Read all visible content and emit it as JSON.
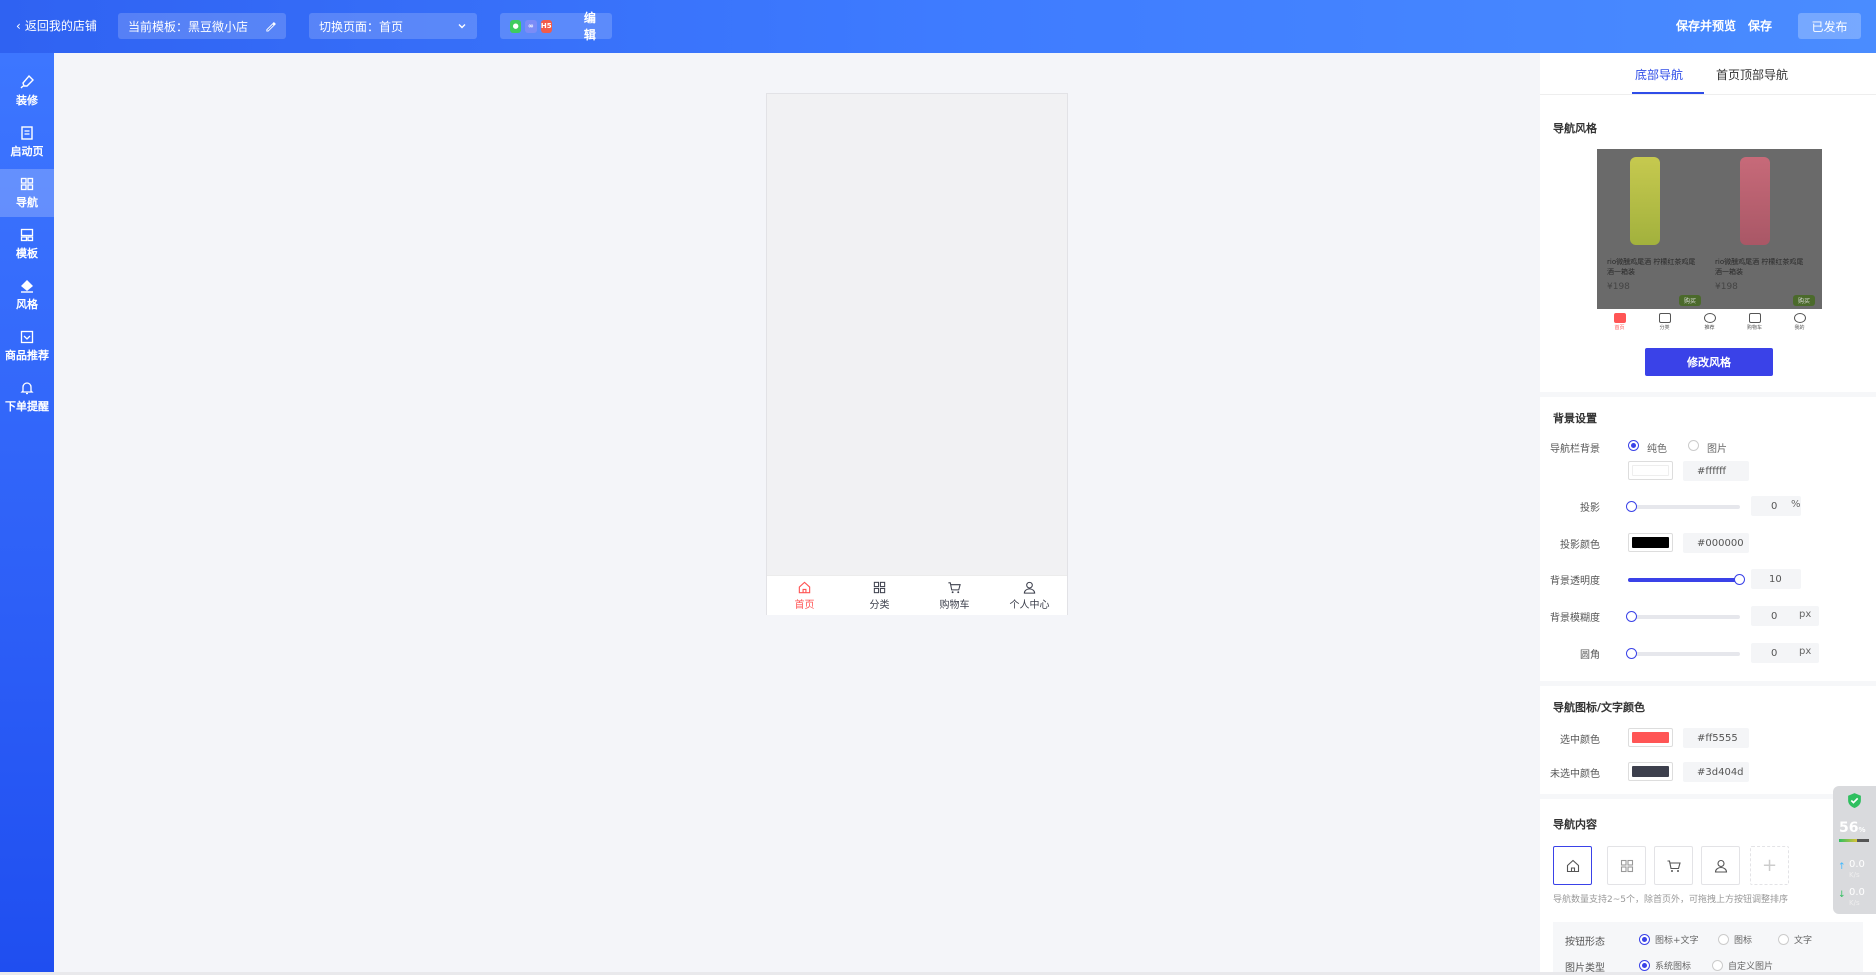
{
  "topbar": {
    "back_label": "返回我的店铺",
    "template_label": "当前模板：黑豆微小店",
    "page_label": "切换页面：首页",
    "share_edit_label": "编辑",
    "share_chip_h5": "H5",
    "save_preview_label": "保存并预览",
    "save_label": "保存",
    "published_label": "已发布"
  },
  "sidebar": {
    "items": [
      {
        "label": "装修",
        "icon": "brush-icon"
      },
      {
        "label": "启动页",
        "icon": "page-icon"
      },
      {
        "label": "导航",
        "icon": "grid-icon"
      },
      {
        "label": "模板",
        "icon": "template-icon"
      },
      {
        "label": "风格",
        "icon": "paint-bucket-icon"
      },
      {
        "label": "商品推荐",
        "icon": "recommend-icon"
      },
      {
        "label": "下单提醒",
        "icon": "bell-icon"
      }
    ],
    "active_index": 2
  },
  "phone": {
    "tabs": [
      {
        "label": "首页",
        "icon": "home-icon"
      },
      {
        "label": "分类",
        "icon": "grid-icon"
      },
      {
        "label": "购物车",
        "icon": "cart-icon"
      },
      {
        "label": "个人中心",
        "icon": "user-icon"
      }
    ]
  },
  "panel": {
    "tabs": [
      "底部导航",
      "首页顶部导航"
    ],
    "active_tab": 0,
    "nav_style": {
      "title": "导航风格",
      "product1": "rio微醺鸡尾酒 柠檬红茶鸡尾酒一箱装",
      "product2": "rio微醺鸡尾酒 柠檬红茶鸡尾酒一箱装",
      "price1": "¥198",
      "price2": "¥198",
      "buy_label": "购买",
      "preview_tabs": [
        "首页",
        "分类",
        "推荐",
        "购物车",
        "我的"
      ],
      "modify_button": "修改风格"
    },
    "background": {
      "title": "背景设置",
      "nav_bg_label": "导航栏背景",
      "option_solid": "纯色",
      "option_image": "图片",
      "bg_color": "#ffffff",
      "shadow_label": "投影",
      "shadow_value": "0",
      "shadow_unit": "%",
      "shadow_color_label": "投影颜色",
      "shadow_color": "#000000",
      "opacity_label": "背景透明度",
      "opacity_value": "10",
      "blur_label": "背景模糊度",
      "blur_value": "0",
      "blur_unit": "px",
      "radius_label": "圆角",
      "radius_value": "0",
      "radius_unit": "px"
    },
    "icon_color": {
      "title": "导航图标/文字颜色",
      "selected_label": "选中颜色",
      "selected_color": "#ff5555",
      "unselected_label": "未选中颜色",
      "unselected_color": "#3d404d"
    },
    "nav_content": {
      "title": "导航内容",
      "icons": [
        "home-icon",
        "grid-icon",
        "cart-icon",
        "user-icon"
      ],
      "add_symbol": "+",
      "hint": "导航数量支持2~5个，除首页外，可拖拽上方按钮调整排序",
      "button_form_label": "按钮形态",
      "form_options": [
        "图标+文字",
        "图标",
        "文字"
      ],
      "image_type_label": "图片类型",
      "image_options": [
        "系统图标",
        "自定义图片"
      ]
    }
  },
  "widget": {
    "percent": "56",
    "percent_unit": "%",
    "up_speed": "0.0",
    "down_speed": "0.0",
    "speed_unit": "K/s"
  },
  "colors": {
    "accent": "#3a42e8",
    "topbar": "#3e7bff",
    "active_tab": "#ff5555",
    "inactive_tab": "#3d404d"
  }
}
